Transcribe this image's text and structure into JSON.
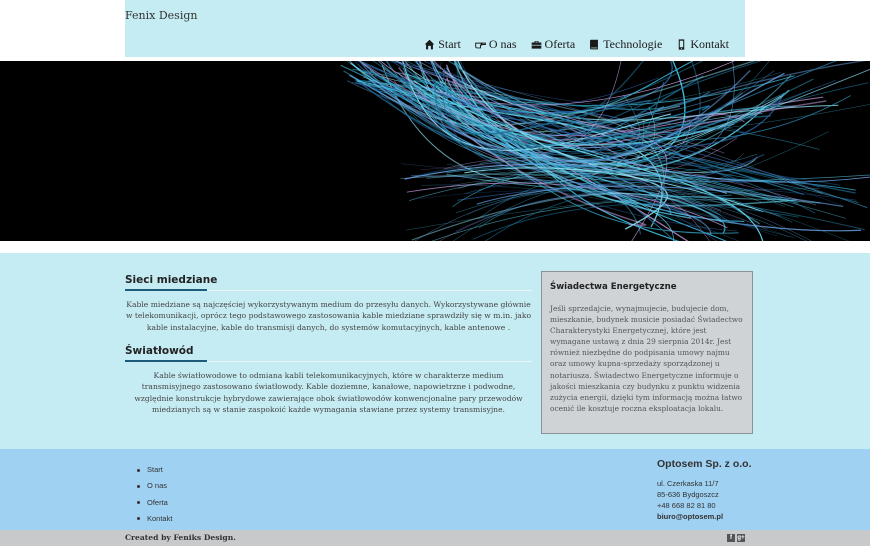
{
  "header": {
    "brand": "Fenix Design",
    "nav": [
      {
        "label": "Start",
        "icon": "home-icon"
      },
      {
        "label": "O nas",
        "icon": "hand-pointer-icon"
      },
      {
        "label": "Oferta",
        "icon": "briefcase-icon"
      },
      {
        "label": "Technologie",
        "icon": "book-icon"
      },
      {
        "label": "Kontakt",
        "icon": "mobile-phone-icon"
      }
    ]
  },
  "articles": [
    {
      "title": "Sieci miedziane",
      "body": "Kable miedziane są najczęściej wykorzystywanym medium do przesyłu danych. Wykorzystywane głównie w telekomunikacji, oprócz tego podstawowego zastosowania kable miedziane sprawdziły się w m.in. jako kable instalacyjne, kable do transmisji danych, do systemów komutacyjnych, kable antenowe ."
    },
    {
      "title": "Światłowód",
      "body": "Kable światłowodowe to odmiana kabli telekomunikacyjnych, które w charakterze medium transmisyjnego zastosowano światłowody. Kable doziemne, kanałowe, napowietrzne i podwodne, względnie konstrukcje hybrydowe zawierające obok światłowodów konwencjonalne pary przewodów miedzianych są w stanie zaspokoić każde wymagania stawiane przez systemy transmisyjne."
    }
  ],
  "aside": {
    "title": "Świadectwa Energetyczne",
    "body": "Jeśli sprzedajcie, wynajmujecie, budujecie dom, mieszkanie, budynek musicie posiadać Świadectwo Charakterystyki Energetycznej, które jest wymagane ustawą z dnia 29 sierpnia 2014r. Jest również niezbędne do podpisania umowy najmu oraz umowy kupna-sprzedaży sporządzonej u notariusza. Świadectwo Energetyczne informuje o jakości mieszkania czy budynku z punktu widzenia zużycia energii, dzięki tym informacją można łatwo ocenić ile kosztuje roczna eksploatacja lokalu."
  },
  "footer": {
    "links": [
      "Start",
      "O nas",
      "Oferta",
      "Kontakt"
    ],
    "company": {
      "name": "Optosem Sp. z o.o.",
      "street": "ul. Czerkaska 11/7",
      "city": "85-636 Bydgoszcz",
      "phone": "+48 668 82 81 80",
      "email": "biuro@optosem.pl"
    }
  },
  "bottombar": {
    "credit": "Created by Feniks Design.",
    "social": [
      {
        "icon": "facebook-icon",
        "glyph": "f"
      },
      {
        "icon": "google-plus-icon",
        "glyph": "g+"
      }
    ]
  },
  "colors": {
    "header_bg": "#c6ecf3",
    "content_bg": "#c6ecf3",
    "footer_bg": "#9fd1f2",
    "bottombar_bg": "#c7c9cb",
    "accent": "#1e5a7a"
  }
}
